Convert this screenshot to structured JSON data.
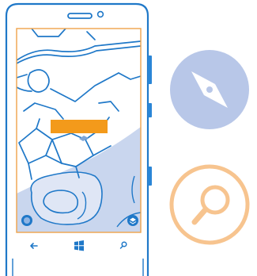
{
  "device": {
    "frame_color": "#1f78c8",
    "screen_border_color": "#f0a24a",
    "map_land_color": "#ffffff",
    "map_water_color": "#c9d6ee",
    "road_color": "#1f78c8"
  },
  "map": {
    "callout_color": "#f39a1b",
    "location_button_icon": "location-dot-icon",
    "layers_button_icon": "layers-icon"
  },
  "navbar": {
    "back_icon": "back-arrow-icon",
    "start_icon": "windows-logo-icon",
    "search_icon": "search-icon"
  },
  "side_icons": {
    "compass": {
      "icon": "compass-icon",
      "color": "#b8c7e8"
    },
    "search": {
      "icon": "magnifier-icon",
      "color": "#f7c48f"
    }
  }
}
